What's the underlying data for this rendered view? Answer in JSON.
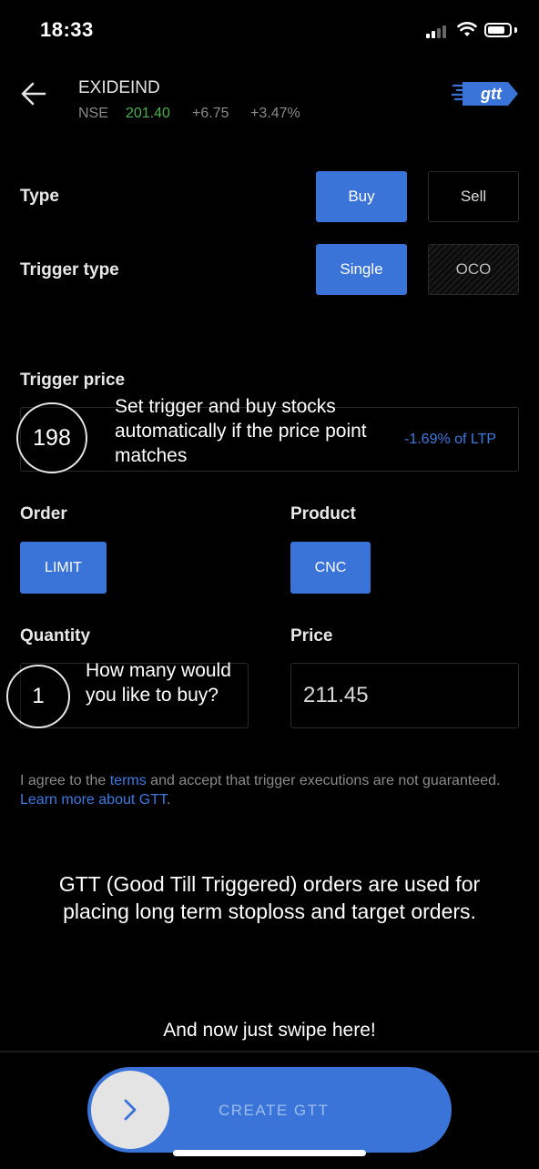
{
  "status_bar": {
    "time": "18:33"
  },
  "header": {
    "symbol": "EXIDEIND",
    "exchange": "NSE",
    "ltp": "201.40",
    "change": "+6.75",
    "change_pct": "+3.47%",
    "logo_text": "gtt"
  },
  "form": {
    "type_label": "Type",
    "type_options": [
      "Buy",
      "Sell"
    ],
    "type_selected": "Buy",
    "trigger_type_label": "Trigger type",
    "trigger_type_options": [
      "Single",
      "OCO"
    ],
    "trigger_type_selected": "Single",
    "trigger_price_label": "Trigger price",
    "trigger_price_value": "198",
    "trigger_price_pct": "-1.69% of LTP",
    "order_label": "Order",
    "order_value": "LIMIT",
    "product_label": "Product",
    "product_value": "CNC",
    "quantity_label": "Quantity",
    "quantity_value": "1",
    "price_label": "Price",
    "price_value": "211.45"
  },
  "hints": {
    "trigger": "Set trigger and buy stocks automatically if the price point matches",
    "quantity": "How many would you like to buy?"
  },
  "terms": {
    "prefix": "I agree to the ",
    "terms_link": "terms",
    "middle": " and accept that trigger executions are not guaranteed. ",
    "learn_link": "Learn more about GTT",
    "suffix": "."
  },
  "info_text": "GTT (Good Till Triggered) orders are used for placing long term stoploss and target orders.",
  "swipe_hint": "And now just swipe here!",
  "slider_label": "CREATE GTT",
  "colors": {
    "accent": "#3a74d8",
    "positive": "#4caf50",
    "background": "#000000"
  }
}
